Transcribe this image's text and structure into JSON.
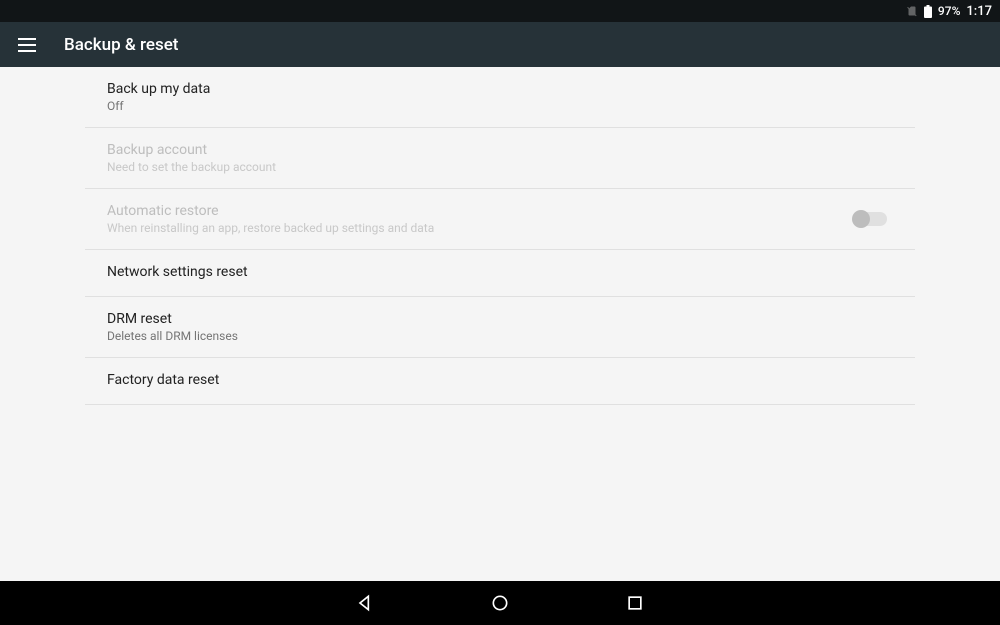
{
  "statusBar": {
    "batteryPct": "97%",
    "time": "1:17"
  },
  "appBar": {
    "title": "Backup & reset"
  },
  "settings": {
    "backupData": {
      "title": "Back up my data",
      "subtitle": "Off"
    },
    "backupAccount": {
      "title": "Backup account",
      "subtitle": "Need to set the backup account"
    },
    "autoRestore": {
      "title": "Automatic restore",
      "subtitle": "When reinstalling an app, restore backed up settings and data"
    },
    "networkReset": {
      "title": "Network settings reset"
    },
    "drmReset": {
      "title": "DRM reset",
      "subtitle": "Deletes all DRM licenses"
    },
    "factoryReset": {
      "title": "Factory data reset"
    }
  }
}
